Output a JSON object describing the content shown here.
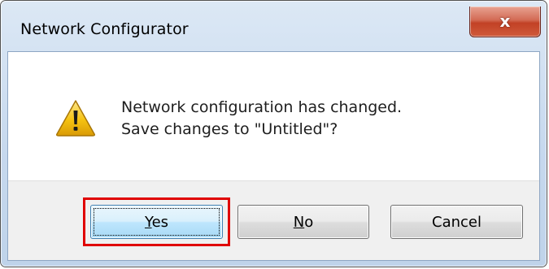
{
  "window": {
    "title": "Network Configurator"
  },
  "title_controls": {
    "close_glyph": "x",
    "close_icon": "close-icon"
  },
  "message": {
    "icon": "warning-icon",
    "line1": "Network configuration has changed.",
    "line2": "Save changes to \"Untitled\"?"
  },
  "buttons": {
    "yes": {
      "mnemonic": "Y",
      "rest": "es"
    },
    "no": {
      "mnemonic": "N",
      "rest": "o"
    },
    "cancel": {
      "label": "Cancel"
    }
  },
  "colors": {
    "highlight": "#e00000",
    "warning_fill": "#f5c211",
    "close_button": "#c24125"
  }
}
